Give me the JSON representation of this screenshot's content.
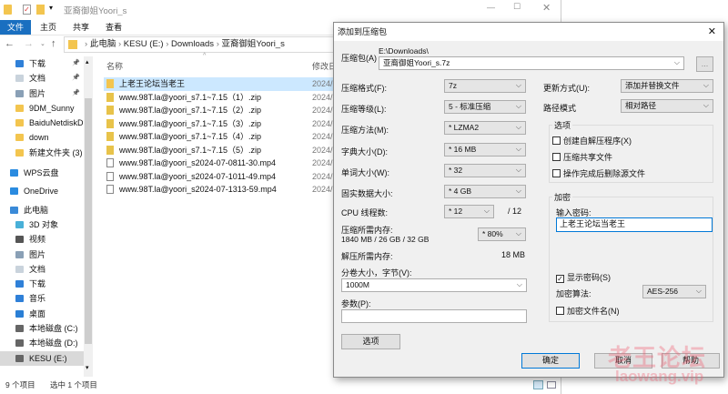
{
  "explorer": {
    "title": "亚裔御姐Yoori_s",
    "ribbon_tabs": [
      "文件",
      "主页",
      "共享",
      "查看"
    ],
    "breadcrumb": [
      "此电脑",
      "KESU (E:)",
      "Downloads",
      "亚裔御姐Yoori_s"
    ],
    "columns": {
      "name": "名称",
      "modified": "修改日"
    },
    "nav_items": [
      {
        "label": "下载",
        "icon": "download-icon",
        "pinned": true
      },
      {
        "label": "文档",
        "icon": "document-icon",
        "pinned": true
      },
      {
        "label": "图片",
        "icon": "picture-icon",
        "pinned": true
      },
      {
        "label": "9DM_Sunny",
        "icon": "folder-icon"
      },
      {
        "label": "BaiduNetdiskD",
        "icon": "folder-icon"
      },
      {
        "label": "down",
        "icon": "folder-icon"
      },
      {
        "label": "新建文件夹 (3)",
        "icon": "folder-icon"
      },
      {
        "label": "WPS云盘",
        "icon": "cloud-icon"
      },
      {
        "label": "OneDrive",
        "icon": "cloud-icon"
      },
      {
        "label": "此电脑",
        "icon": "computer-icon"
      },
      {
        "label": "3D 对象",
        "icon": "3d-icon"
      },
      {
        "label": "视频",
        "icon": "video-icon"
      },
      {
        "label": "图片",
        "icon": "picture-icon"
      },
      {
        "label": "文档",
        "icon": "document-icon"
      },
      {
        "label": "下载",
        "icon": "download-icon"
      },
      {
        "label": "音乐",
        "icon": "music-icon"
      },
      {
        "label": "桌面",
        "icon": "desktop-icon"
      },
      {
        "label": "本地磁盘 (C:)",
        "icon": "drive-icon"
      },
      {
        "label": "本地磁盘 (D:)",
        "icon": "drive-icon"
      },
      {
        "label": "KESU (E:)",
        "icon": "drive-icon"
      }
    ],
    "files": [
      {
        "name": "上老王论坛当老王",
        "date": "2024/",
        "type": "folder"
      },
      {
        "name": "www.98T.la@yoori_s7.1~7.15（1）.zip",
        "date": "2024/",
        "type": "zip"
      },
      {
        "name": "www.98T.la@yoori_s7.1~7.15（2）.zip",
        "date": "2024/",
        "type": "zip"
      },
      {
        "name": "www.98T.la@yoori_s7.1~7.15（3）.zip",
        "date": "2024/",
        "type": "zip"
      },
      {
        "name": "www.98T.la@yoori_s7.1~7.15（4）.zip",
        "date": "2024/",
        "type": "zip"
      },
      {
        "name": "www.98T.la@yoori_s7.1~7.15（5）.zip",
        "date": "2024/",
        "type": "zip"
      },
      {
        "name": "www.98T.la@yoori_s2024-07-0811-30.mp4",
        "date": "2024/",
        "type": "mp4"
      },
      {
        "name": "www.98T.la@yoori_s2024-07-1011-49.mp4",
        "date": "2024/",
        "type": "mp4"
      },
      {
        "name": "www.98T.la@yoori_s2024-07-1313-59.mp4",
        "date": "2024/",
        "type": "mp4"
      }
    ],
    "status": {
      "count": "9 个项目",
      "selected": "选中 1 个项目"
    }
  },
  "dialog": {
    "title": "添加到压缩包",
    "archive_label": "压缩包(A)",
    "archive_dir": "E:\\Downloads\\",
    "archive_name": "亚裔御姐Yoori_s.7z",
    "browse": "...",
    "format_label": "压缩格式(F):",
    "format": "7z",
    "level_label": "压缩等级(L):",
    "level": "5 - 标准压缩",
    "method_label": "压缩方法(M):",
    "method": "* LZMA2",
    "dict_label": "字典大小(D):",
    "dict": "* 16 MB",
    "word_label": "单词大小(W):",
    "word": "* 32",
    "solid_label": "固实数据大小:",
    "solid": "* 4 GB",
    "cpu_label": "CPU 线程数:",
    "cpu": "* 12",
    "cpu_max": "/ 12",
    "mem_label": "压缩所需内存:",
    "mem_value": "1840 MB / 26 GB / 32 GB",
    "mem_pct": "* 80%",
    "dmem_label": "解压所需内存:",
    "dmem_value": "18 MB",
    "volume_label": "分卷大小，字节(V):",
    "volume": "1000M",
    "params_label": "参数(P):",
    "params": "",
    "options_button": "选项",
    "update_label": "更新方式(U):",
    "update": "添加并替换文件",
    "path_label": "路径模式",
    "path": "相对路径",
    "options_group": "选项",
    "options": [
      {
        "label": "创建自解压程序(X)",
        "checked": false
      },
      {
        "label": "压缩共享文件",
        "checked": false
      },
      {
        "label": "操作完成后删除源文件",
        "checked": false
      }
    ],
    "enc_group": "加密",
    "pwd_label": "输入密码:",
    "pwd": "上老王论坛当老王",
    "show_pwd": "显示密码(S)",
    "enc_method_label": "加密算法:",
    "enc_method": "AES-256",
    "enc_names": "加密文件名(N)",
    "ok": "确定",
    "cancel": "取消",
    "help": "帮助"
  },
  "watermark": {
    "line1": "老王论坛",
    "line2": "laowang.vip"
  }
}
